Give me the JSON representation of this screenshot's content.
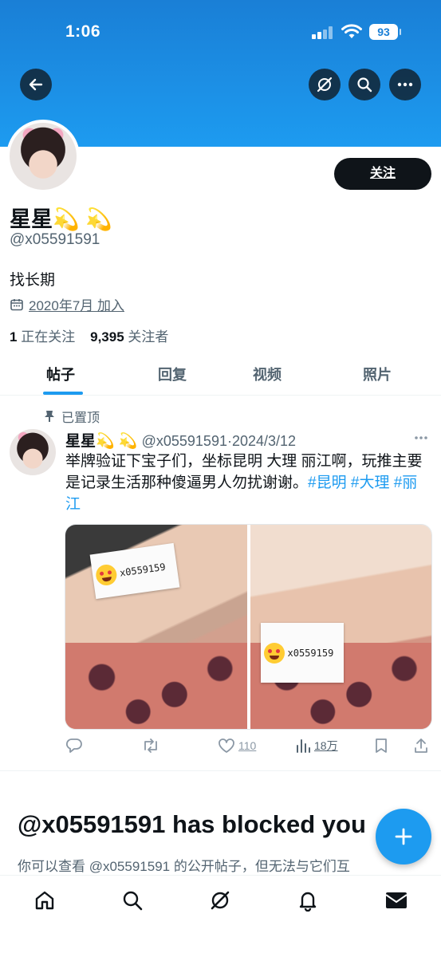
{
  "status_bar": {
    "time": "1:06",
    "battery": "93"
  },
  "profile": {
    "name": "星星💫 💫",
    "handle": "@x05591591",
    "bio": "找长期",
    "joined": "2020年7月 加入",
    "following_count": "1",
    "following_label": "正在关注",
    "followers_count": "9,395",
    "followers_label": "关注者",
    "follow_button": "关注"
  },
  "tabs": [
    {
      "label": "帖子",
      "active": true
    },
    {
      "label": "回复",
      "active": false
    },
    {
      "label": "视频",
      "active": false
    },
    {
      "label": "照片",
      "active": false
    }
  ],
  "tweet": {
    "pinned_label": "已置顶",
    "author": "星星💫 💫",
    "handle_date": "@x05591591·2024/3/12",
    "text": "举牌验证下宝子们，坐标昆明 大理 丽江啊，玩推主要是记录生活那种傻逼男人勿扰谢谢。",
    "hashtags": [
      "#昆明",
      "#大理",
      "#丽江"
    ],
    "card_text_1": "x0559159",
    "card_text_2": "x0559159",
    "likes": "110",
    "views": "18万"
  },
  "blocked": {
    "title": "@x05591591 has blocked you",
    "subtitle": "你可以查看 @x05591591 的公开帖子，但无法与它们互"
  },
  "icons": {
    "back": "arrow-left-icon",
    "grok": "slash-circle-icon",
    "search": "search-icon",
    "more": "more-icon"
  },
  "colors": {
    "accent": "#1d9bf0",
    "text": "#0f1419",
    "muted": "#536471"
  }
}
